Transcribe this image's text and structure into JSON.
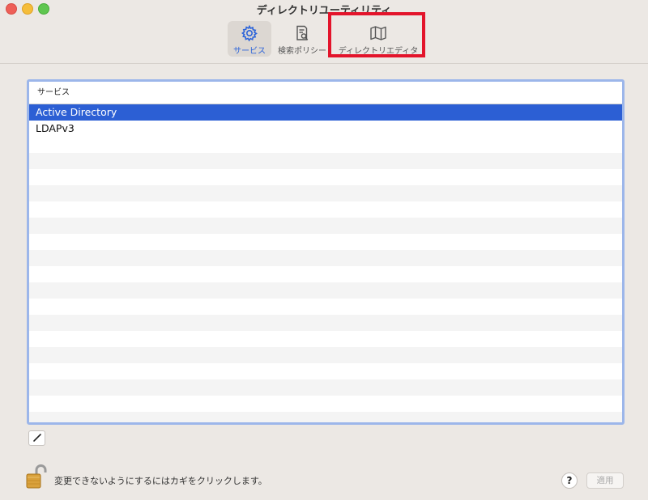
{
  "window": {
    "title": "ディレクトリユーティリティ"
  },
  "toolbar": {
    "items": [
      {
        "label": "サービス",
        "icon": "gear-icon",
        "selected": true
      },
      {
        "label": "検索ポリシー",
        "icon": "search-policy-icon",
        "selected": false
      },
      {
        "label": "ディレクトリエディタ",
        "icon": "map-icon",
        "selected": false
      }
    ]
  },
  "services_table": {
    "header": "サービス",
    "rows": [
      "Active Directory",
      "LDAPv3"
    ],
    "selected_row": "Active Directory"
  },
  "footer": {
    "lock_message": "変更できないようにするにはカギをクリックします。",
    "help_label": "?",
    "apply_label": "適用"
  },
  "colors": {
    "accent": "#2b63d9",
    "selection": "#2c5fd4",
    "highlight_box": "#e3142b"
  }
}
